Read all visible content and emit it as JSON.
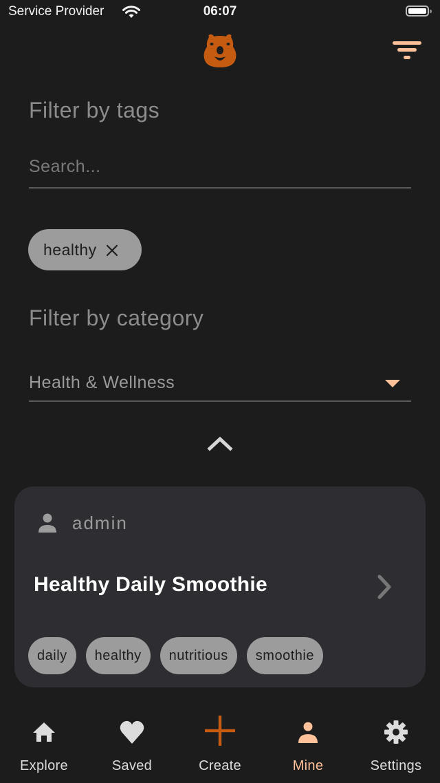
{
  "status_bar": {
    "carrier": "Service Provider",
    "time": "06:07",
    "wifi_icon": "wifi-icon",
    "battery_icon": "battery-icon"
  },
  "header": {
    "logo_icon": "bear-logo-icon",
    "filter_icon": "filter-icon"
  },
  "colors": {
    "background": "#1c1c1c",
    "card": "#2e2d32",
    "accent": "#c55a11",
    "accent_light": "#ffc19a",
    "chip": "#9c9c9c"
  },
  "filters": {
    "tags_title": "Filter by tags",
    "search_placeholder": "Search...",
    "search_value": "",
    "selected_tags": [
      {
        "label": "healthy",
        "remove_icon": "close-icon"
      }
    ],
    "category_title": "Filter by category",
    "category_selected": "Health & Wellness",
    "collapse_icon": "chevron-up-icon"
  },
  "results": [
    {
      "author": "admin",
      "title": "Healthy Daily Smoothie",
      "tags": [
        "daily",
        "healthy",
        "nutritious",
        "smoothie"
      ]
    }
  ],
  "tabbar": {
    "items": [
      {
        "label": "Explore",
        "icon": "home-icon",
        "active": false
      },
      {
        "label": "Saved",
        "icon": "heart-icon",
        "active": false
      },
      {
        "label": "Create",
        "icon": "plus-icon",
        "active": false
      },
      {
        "label": "Mine",
        "icon": "person-icon",
        "active": true
      },
      {
        "label": "Settings",
        "icon": "gear-icon",
        "active": false
      }
    ]
  }
}
